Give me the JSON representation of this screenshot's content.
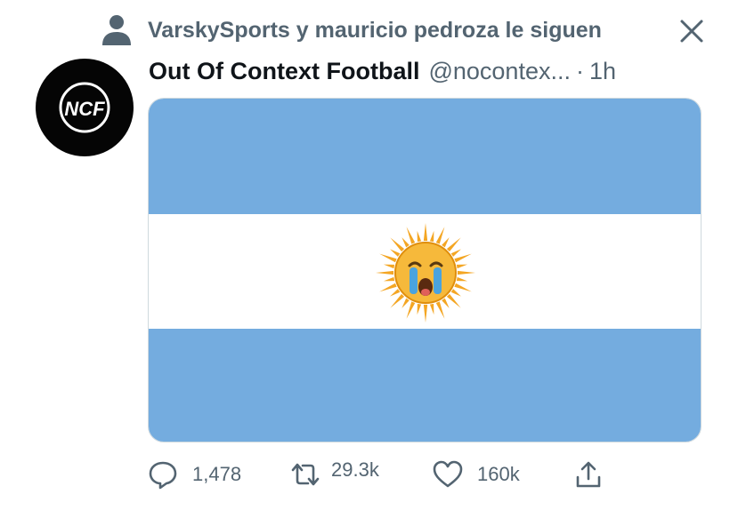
{
  "social_context": {
    "text": "VarskySports y mauricio pedroza le siguen",
    "icon": "person-icon"
  },
  "tweet": {
    "avatar_text": "NCF",
    "display_name": "Out Of Context Football",
    "handle": "@nocontex...",
    "separator": "·",
    "timestamp": "1h",
    "media": {
      "description_icon": "argentina-flag-image",
      "emoji": "crying-sun-emoji"
    },
    "actions": {
      "replies": "1,478",
      "retweets": "29.3k",
      "likes": "160k"
    }
  },
  "colors": {
    "flag_blue": "#74acdf",
    "secondary_text": "#536471",
    "primary_text": "#0f1419"
  }
}
